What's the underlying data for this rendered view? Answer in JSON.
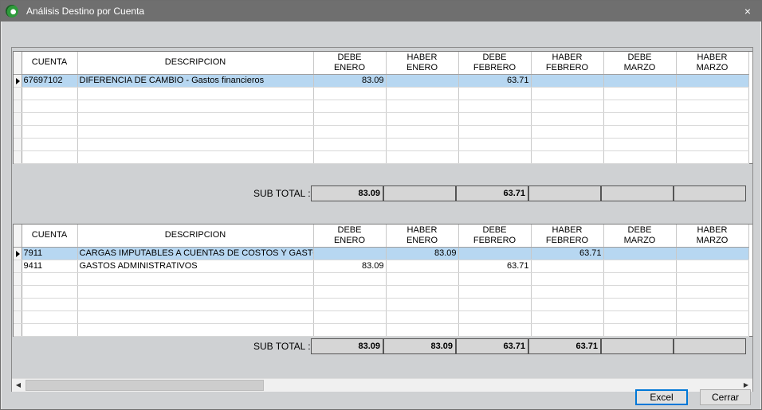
{
  "window": {
    "title": "Análisis Destino por Cuenta",
    "close_glyph": "×",
    "icon": "app-logo-icon"
  },
  "columns": [
    {
      "l1": "CUENTA",
      "l2": ""
    },
    {
      "l1": "DESCRIPCION",
      "l2": ""
    },
    {
      "l1": "DEBE",
      "l2": "ENERO"
    },
    {
      "l1": "HABER",
      "l2": "ENERO"
    },
    {
      "l1": "DEBE",
      "l2": "FEBRERO"
    },
    {
      "l1": "HABER",
      "l2": "FEBRERO"
    },
    {
      "l1": "DEBE",
      "l2": "MARZO"
    },
    {
      "l1": "HABER",
      "l2": "MARZO"
    }
  ],
  "grid1": {
    "rows": [
      {
        "cuenta": "67697102",
        "descripcion": "DIFERENCIA DE CAMBIO - Gastos financieros",
        "debe_enero": "83.09",
        "haber_enero": "",
        "debe_febrero": "63.71",
        "haber_febrero": "",
        "debe_marzo": "",
        "haber_marzo": ""
      }
    ],
    "subtotal_label": "SUB TOTAL :",
    "subtotal": [
      "83.09",
      "",
      "63.71",
      "",
      "",
      ""
    ]
  },
  "grid2": {
    "rows": [
      {
        "cuenta": "7911",
        "descripcion": "CARGAS IMPUTABLES A CUENTAS DE COSTOS Y GASTOS",
        "debe_enero": "",
        "haber_enero": "83.09",
        "debe_febrero": "",
        "haber_febrero": "63.71",
        "debe_marzo": "",
        "haber_marzo": ""
      },
      {
        "cuenta": "9411",
        "descripcion": "GASTOS ADMINISTRATIVOS",
        "debe_enero": "83.09",
        "haber_enero": "",
        "debe_febrero": "63.71",
        "haber_febrero": "",
        "debe_marzo": "",
        "haber_marzo": ""
      }
    ],
    "subtotal_label": "SUB TOTAL :",
    "subtotal": [
      "83.09",
      "83.09",
      "63.71",
      "63.71",
      "",
      ""
    ]
  },
  "scrollbar": {
    "left_glyph": "◀",
    "right_glyph": "▶"
  },
  "buttons": {
    "excel": "Excel",
    "cerrar": "Cerrar"
  }
}
